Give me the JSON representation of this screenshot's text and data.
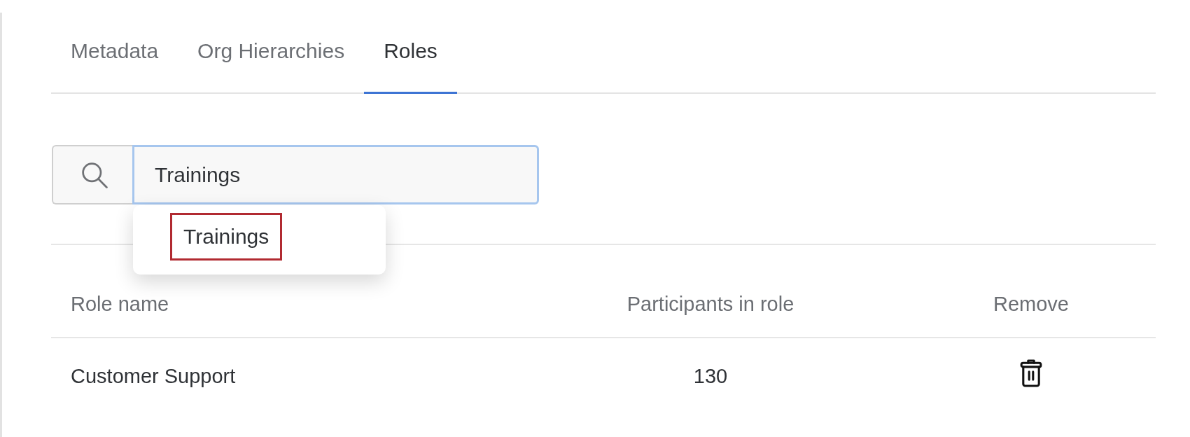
{
  "tabs": [
    {
      "label": "Metadata",
      "selected": false
    },
    {
      "label": "Org Hierarchies",
      "selected": false
    },
    {
      "label": "Roles",
      "selected": true
    }
  ],
  "search": {
    "value": "Trainings",
    "focused": true
  },
  "suggestions": [
    {
      "label": "Trainings",
      "highlighted": true
    }
  ],
  "table": {
    "columns": [
      "Role name",
      "Participants in role",
      "Remove"
    ],
    "rows": [
      {
        "role_name": "Customer Support",
        "participants": "130"
      }
    ]
  }
}
